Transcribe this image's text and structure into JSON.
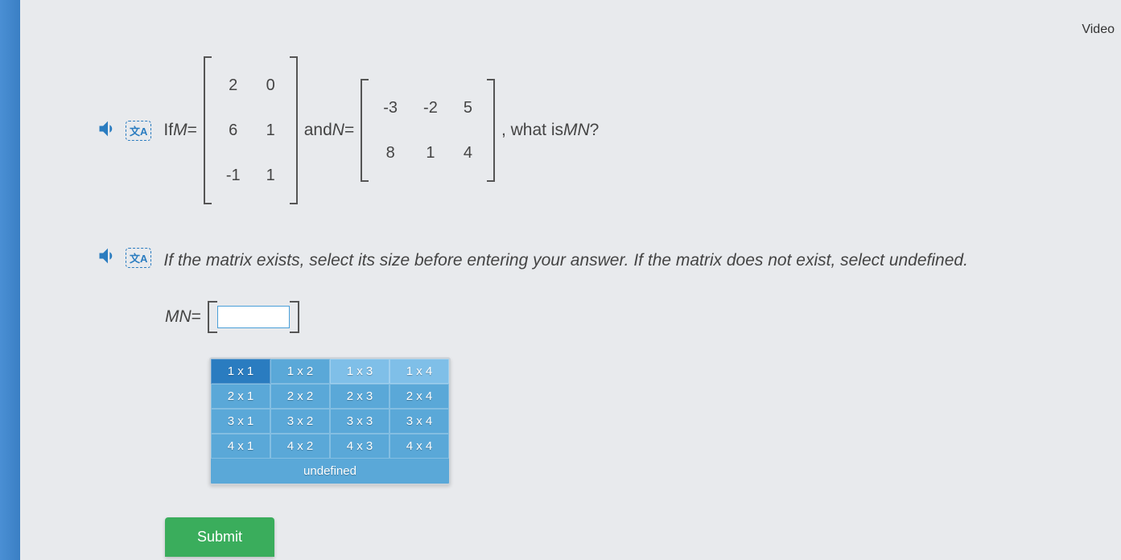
{
  "video_link": "Video",
  "question": {
    "prefix": "If ",
    "m_label": "M",
    "equals": " = ",
    "matrix_m": [
      [
        "2",
        "0"
      ],
      [
        "6",
        "1"
      ],
      [
        "-1",
        "1"
      ]
    ],
    "and": " and ",
    "n_label": "N",
    "matrix_n": [
      [
        "-3",
        "-2",
        "5"
      ],
      [
        "8",
        "1",
        "4"
      ]
    ],
    "suffix": ", what is ",
    "mn_label": "MN",
    "qmark": "?"
  },
  "instruction": "If the matrix exists, select its size before entering your answer. If the matrix does not exist, select undefined.",
  "answer": {
    "label": "MN",
    "equals": " = "
  },
  "size_grid": {
    "rows": [
      [
        "1 x 1",
        "1 x 2",
        "1 x 3",
        "1 x 4"
      ],
      [
        "2 x 1",
        "2 x 2",
        "2 x 3",
        "2 x 4"
      ],
      [
        "3 x 1",
        "3 x 2",
        "3 x 3",
        "3 x 4"
      ],
      [
        "4 x 1",
        "4 x 2",
        "4 x 3",
        "4 x 4"
      ]
    ],
    "undefined": "undefined",
    "selected": "1 x 1"
  },
  "submit": "Submit"
}
